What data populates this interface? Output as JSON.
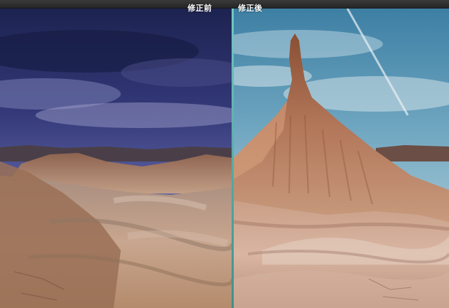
{
  "compare": {
    "before_label": "修正前",
    "after_label": "修正後"
  }
}
